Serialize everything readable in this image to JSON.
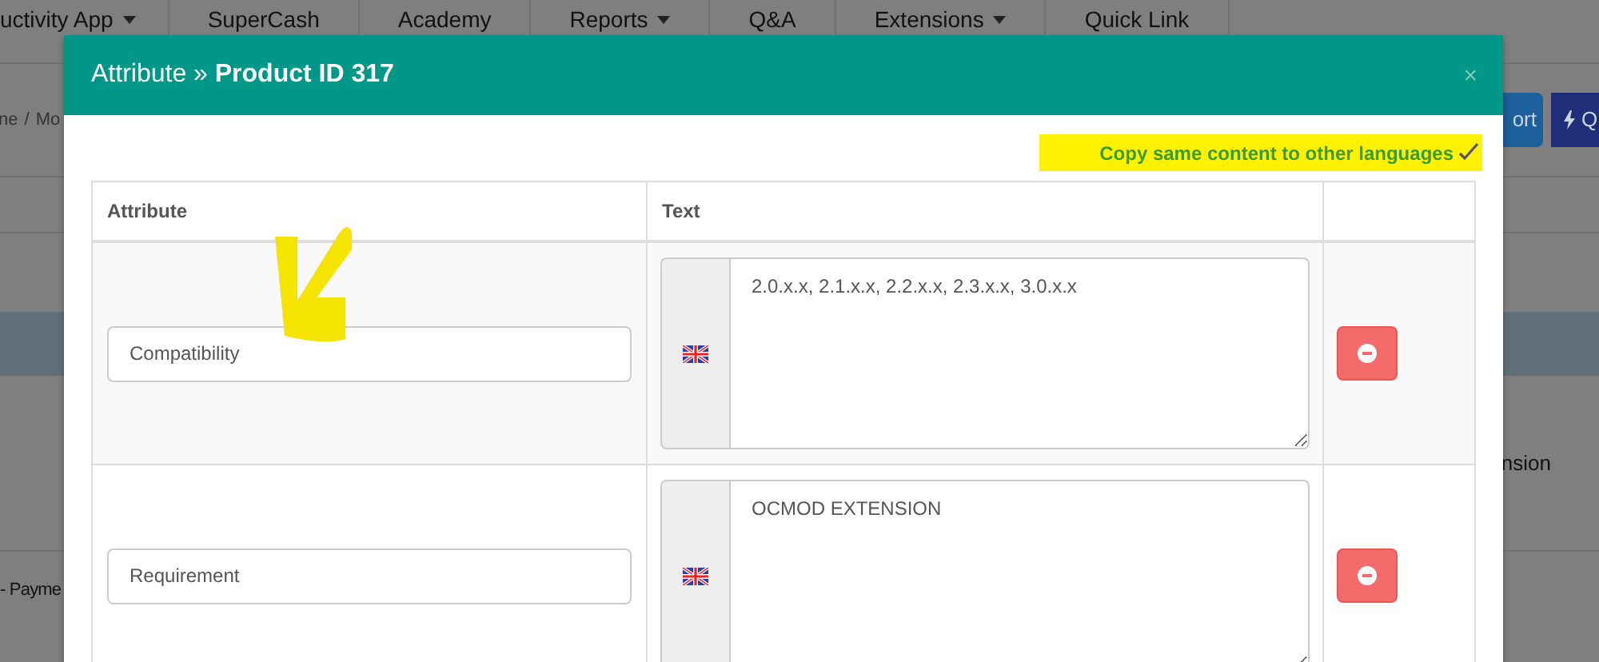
{
  "nav": [
    {
      "label": "uctivity App",
      "dropdown": true
    },
    {
      "label": "SuperCash",
      "dropdown": false
    },
    {
      "label": "Academy",
      "dropdown": false
    },
    {
      "label": "Reports",
      "dropdown": true
    },
    {
      "label": "Q&A",
      "dropdown": false
    },
    {
      "label": "Extensions",
      "dropdown": true
    },
    {
      "label": "Quick Link",
      "dropdown": false
    }
  ],
  "breadcrumb": [
    "ne",
    "Mo"
  ],
  "breadcrumb_separator": "/",
  "header_buttons": [
    {
      "label": "ort",
      "kind": "plain"
    },
    {
      "label": "Q",
      "kind": "bolt"
    }
  ],
  "page_texts": [
    "nsion",
    "- Payme"
  ],
  "modal": {
    "title": "Attribute » **Product ID 317**",
    "close": "×",
    "copy_option": {
      "label": "Copy same content to other languages",
      "checked": true
    },
    "table": {
      "columns": [
        "Attribute",
        "Text"
      ],
      "rows": [
        {
          "attribute": "Compatibility",
          "text": "2.0.x.x, 2.1.x.x, 2.2.x.x, 2.3.x.x, 3.0.x.x"
        },
        {
          "attribute": "Requirement",
          "text": "OCMOD EXTENSION"
        }
      ]
    }
  }
}
